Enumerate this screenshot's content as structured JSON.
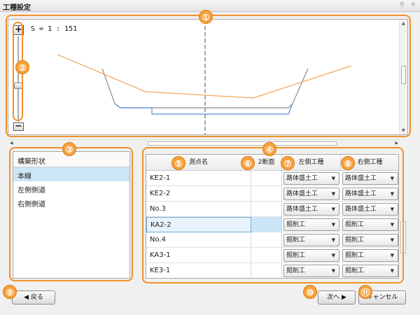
{
  "window": {
    "title": "工種設定",
    "pin_icon": "pin-icon",
    "close_icon": "close-icon"
  },
  "preview": {
    "scale_label": "S = 1 : 151",
    "zoom_in": "+",
    "zoom_out": "−"
  },
  "shape_panel": {
    "header": "構築形状",
    "items": [
      {
        "label": "本線",
        "selected": true
      },
      {
        "label": "左側側道",
        "selected": false
      },
      {
        "label": "右側側道",
        "selected": false
      }
    ]
  },
  "grid": {
    "headers": {
      "name": "測点名",
      "two": "2断面",
      "left": "左側工種",
      "right": "右側工種"
    },
    "rows": [
      {
        "name": "KE2-1",
        "left": "路体盛土工",
        "right": "路体盛土工",
        "selected": false
      },
      {
        "name": "KE2-2",
        "left": "路体盛土工",
        "right": "路体盛土工",
        "selected": false
      },
      {
        "name": "No.3",
        "left": "路体盛土工",
        "right": "路体盛土工",
        "selected": false
      },
      {
        "name": "KA2-2",
        "left": "掘削工",
        "right": "掘削工",
        "selected": true
      },
      {
        "name": "No.4",
        "left": "掘削工",
        "right": "掘削工",
        "selected": false
      },
      {
        "name": "KA3-1",
        "left": "掘削工",
        "right": "掘削工",
        "selected": false
      },
      {
        "name": "KE3-1",
        "left": "掘削工",
        "right": "掘削工",
        "selected": false
      }
    ]
  },
  "buttons": {
    "back": "◀ 戻る",
    "next": "次へ ▶",
    "cancel": "キャンセル"
  },
  "annotations": [
    "①",
    "②",
    "③",
    "④",
    "⑤",
    "⑥",
    "⑦",
    "⑧",
    "⑨",
    "⑩",
    "⑪"
  ],
  "colors": {
    "annotation": "#f0922e",
    "selection": "#cde6f7",
    "design_line": "#f4a259",
    "ground_line": "#888888",
    "bottom_line": "#5b8fd9",
    "center_line": "#6f8fb0"
  }
}
